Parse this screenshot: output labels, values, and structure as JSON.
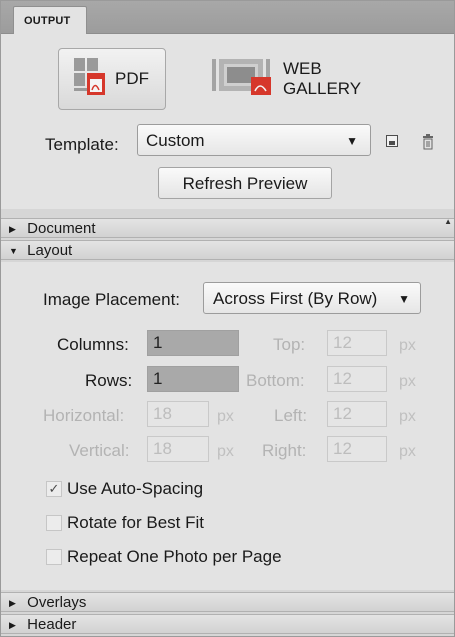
{
  "tab": {
    "label": "OUTPUT"
  },
  "output": {
    "pdf_label": "PDF",
    "web_gallery_label": "WEB GALLERY",
    "template_label": "Template:",
    "template_value": "Custom",
    "refresh_label": "Refresh Preview"
  },
  "sections": {
    "document": "Document",
    "layout": "Layout",
    "overlays": "Overlays",
    "header": "Header"
  },
  "layout": {
    "image_placement_label": "Image Placement:",
    "image_placement_value": "Across First (By Row)",
    "columns_label": "Columns:",
    "columns_value": "1",
    "rows_label": "Rows:",
    "rows_value": "1",
    "horizontal_label": "Horizontal:",
    "horizontal_value": "18",
    "vertical_label": "Vertical:",
    "vertical_value": "18",
    "top_label": "Top:",
    "top_value": "12",
    "bottom_label": "Bottom:",
    "bottom_value": "12",
    "left_label": "Left:",
    "left_value": "12",
    "right_label": "Right:",
    "right_value": "12",
    "unit": "px",
    "auto_spacing_label": "Use Auto-Spacing",
    "auto_spacing_checked": true,
    "rotate_label": "Rotate for Best Fit",
    "rotate_checked": false,
    "repeat_label": "Repeat One Photo per Page",
    "repeat_checked": false
  },
  "glyphs": {
    "collapsed": "▶",
    "expanded": "▼",
    "check": "✓"
  },
  "icons": [
    "pdf-icon",
    "web-gallery-icon",
    "save-template-icon",
    "delete-template-icon",
    "dropdown-caret-icon",
    "scroll-up-icon"
  ],
  "colors": {
    "accent_red": "#d6372b",
    "panel_bg": "#e3e3e3",
    "active_field": "#a9a9a9"
  }
}
